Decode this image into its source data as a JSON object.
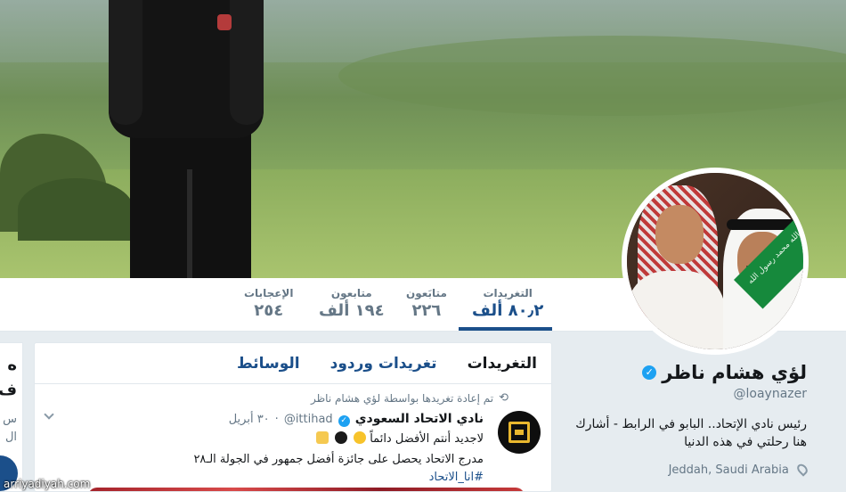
{
  "profile": {
    "name": "لؤي هشام ناظر",
    "handle": "@loaynazer",
    "bio": "رئيس نادي الإتحاد.. البابو في الرابط - أشارك هنا رحلتي في هذه الدنيا",
    "location": "Jeddah, Saudi Arabia",
    "verified_icon": "verified-badge",
    "avatar_flag_text": "لا إله إلا الله محمد رسول الله"
  },
  "stats": [
    {
      "label": "التغريدات",
      "value": "٨٠٫٢ ألف",
      "active": true
    },
    {
      "label": "متابَعون",
      "value": "٢٢٦",
      "active": false
    },
    {
      "label": "متابعون",
      "value": "١٩٤ ألف",
      "active": false
    },
    {
      "label": "الإعجابات",
      "value": "٢٥٤",
      "active": false
    }
  ],
  "timeline": {
    "tabs": [
      {
        "label": "التغريدات",
        "active": true
      },
      {
        "label": "تغريدات وردود",
        "active": false
      },
      {
        "label": "الوسائط",
        "active": false
      }
    ],
    "tweet": {
      "retweet_note": "تم إعادة تغريدها بواسطة لؤي هشام ناظر",
      "author": "نادي الاتحاد السعودي",
      "handle": "@ittihad",
      "date": "٣٠ أبريل",
      "line1": "لاجديد أنتم الأفضل دائماً",
      "line2": "مدرج الاتحاد يحصل على جائزة أفضل جمهور في الجولة الـ٢٨",
      "hashtag": "#انا_الاتحاد"
    }
  },
  "left_card": {
    "line1": "ه",
    "line2": "ف",
    "line3": "س",
    "line4": "ال"
  },
  "watermark": "arriyadiyah.com",
  "colors": {
    "accent": "#1b4f8a",
    "verified": "#1da1f2",
    "muted": "#657786",
    "background": "#e6ecf0"
  }
}
